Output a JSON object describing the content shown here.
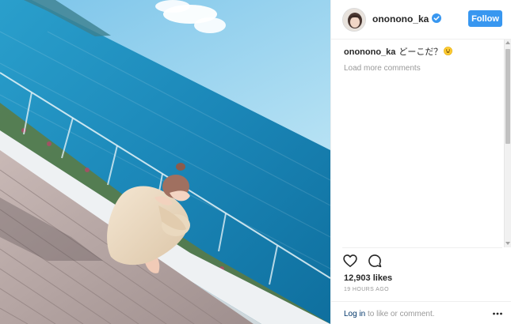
{
  "header": {
    "username": "ononono_ka",
    "follow_label": "Follow",
    "verified_icon": "verified-badge-icon"
  },
  "comments": {
    "caption_user": "ononono_ka",
    "caption_text": "どーこだ？",
    "caption_emoji": "grinning-face-emoji",
    "load_more": "Load more comments"
  },
  "actions": {
    "like_icon": "heart-icon",
    "comment_icon": "speech-bubble-icon",
    "more_icon": "ellipsis-icon"
  },
  "stats": {
    "likes": "12,903 likes",
    "time_ago": "19 HOURS AGO"
  },
  "footer": {
    "login_link": "Log in",
    "login_rest": " to like or comment."
  },
  "colors": {
    "follow_button": "#3897f0",
    "sea": "#1f8fbf",
    "sky": "#8fd0ee",
    "deck": "#b9a9a7"
  }
}
